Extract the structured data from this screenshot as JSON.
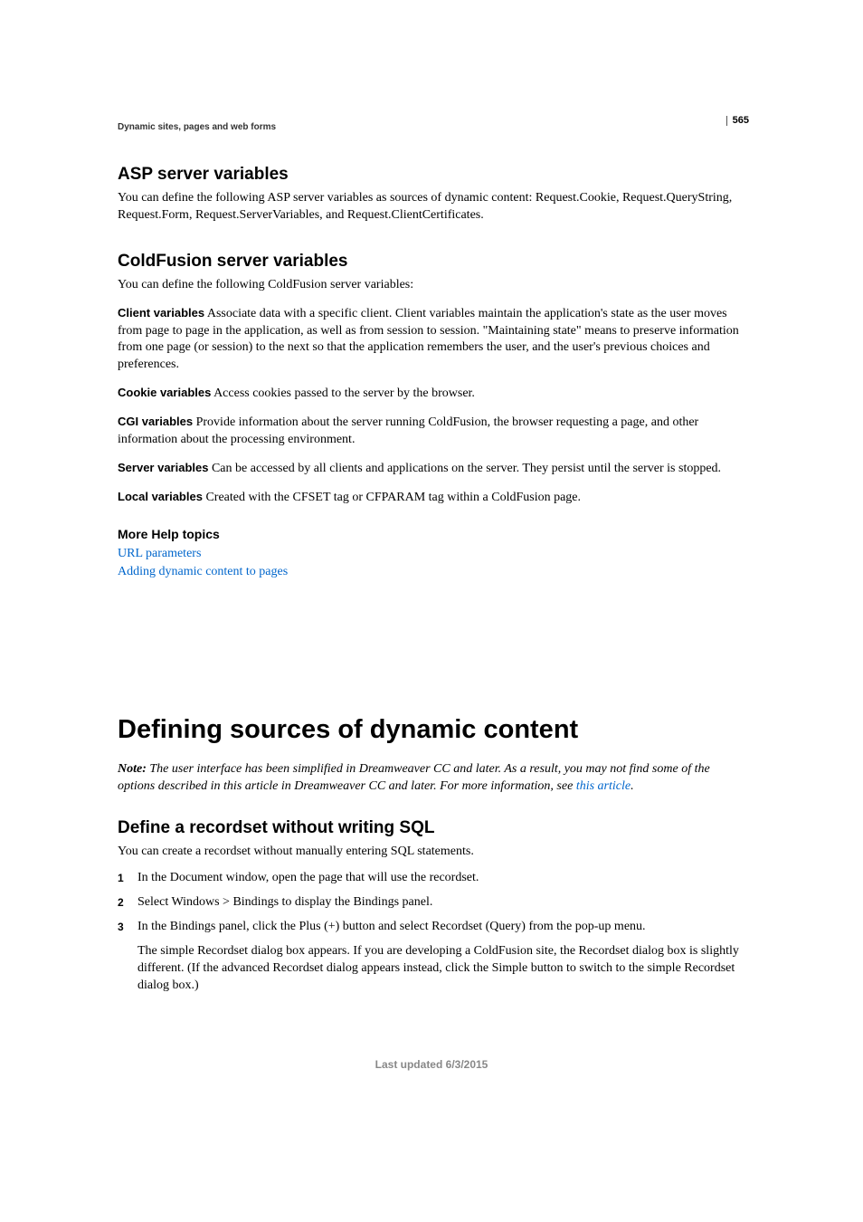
{
  "pageNumber": "565",
  "breadcrumb": "Dynamic sites, pages and web forms",
  "section1": {
    "title": "ASP server variables",
    "body": "You can define the following ASP server variables as sources of dynamic content: Request.Cookie, Request.QueryString, Request.Form, Request.ServerVariables, and Request.ClientCertificates."
  },
  "section2": {
    "title": "ColdFusion server variables",
    "intro": "You can define the following ColdFusion server variables:",
    "vars": [
      {
        "term": "Client variables",
        "desc": "Associate data with a specific client. Client variables maintain the application's state as the user moves from page to page in the application, as well as from session to session. \"Maintaining state\" means to preserve information from one page (or session) to the next so that the application remembers the user, and the user's previous choices and preferences."
      },
      {
        "term": "Cookie variables",
        "desc": "Access cookies passed to the server by the browser."
      },
      {
        "term": "CGI variables",
        "desc": "Provide information about the server running ColdFusion, the browser requesting a page, and other information about the processing environment."
      },
      {
        "term": "Server variables",
        "desc": "Can be accessed by all clients and applications on the server. They persist until the server is stopped."
      },
      {
        "term": "Local variables",
        "desc": "Created with the CFSET tag or CFPARAM tag within a ColdFusion page."
      }
    ]
  },
  "moreHelp": {
    "title": "More Help topics",
    "links": [
      "URL parameters",
      "Adding dynamic content to pages"
    ]
  },
  "chapter": {
    "title": "Defining sources of dynamic content",
    "noteLabel": "Note:",
    "notePre": " The user interface has been simplified in Dreamweaver CC and later. As a result, you may not find some of the options described in this article in Dreamweaver CC and later. For more information, see ",
    "noteLink": "this article",
    "notePost": "."
  },
  "section3": {
    "title": "Define a recordset without writing SQL",
    "intro": "You can create a recordset without manually entering SQL statements.",
    "steps": [
      {
        "text": "In the Document window, open the page that will use the recordset."
      },
      {
        "text": "Select Windows > Bindings to display the Bindings panel."
      },
      {
        "text": "In the Bindings panel, click the Plus (+) button and select Recordset (Query) from the pop-up menu.",
        "body": "The simple Recordset dialog box appears. If you are developing a ColdFusion site, the Recordset dialog box is slightly different. (If the advanced Recordset dialog appears instead, click the Simple button to switch to the simple Recordset dialog box.)"
      }
    ]
  },
  "footer": "Last updated 6/3/2015"
}
